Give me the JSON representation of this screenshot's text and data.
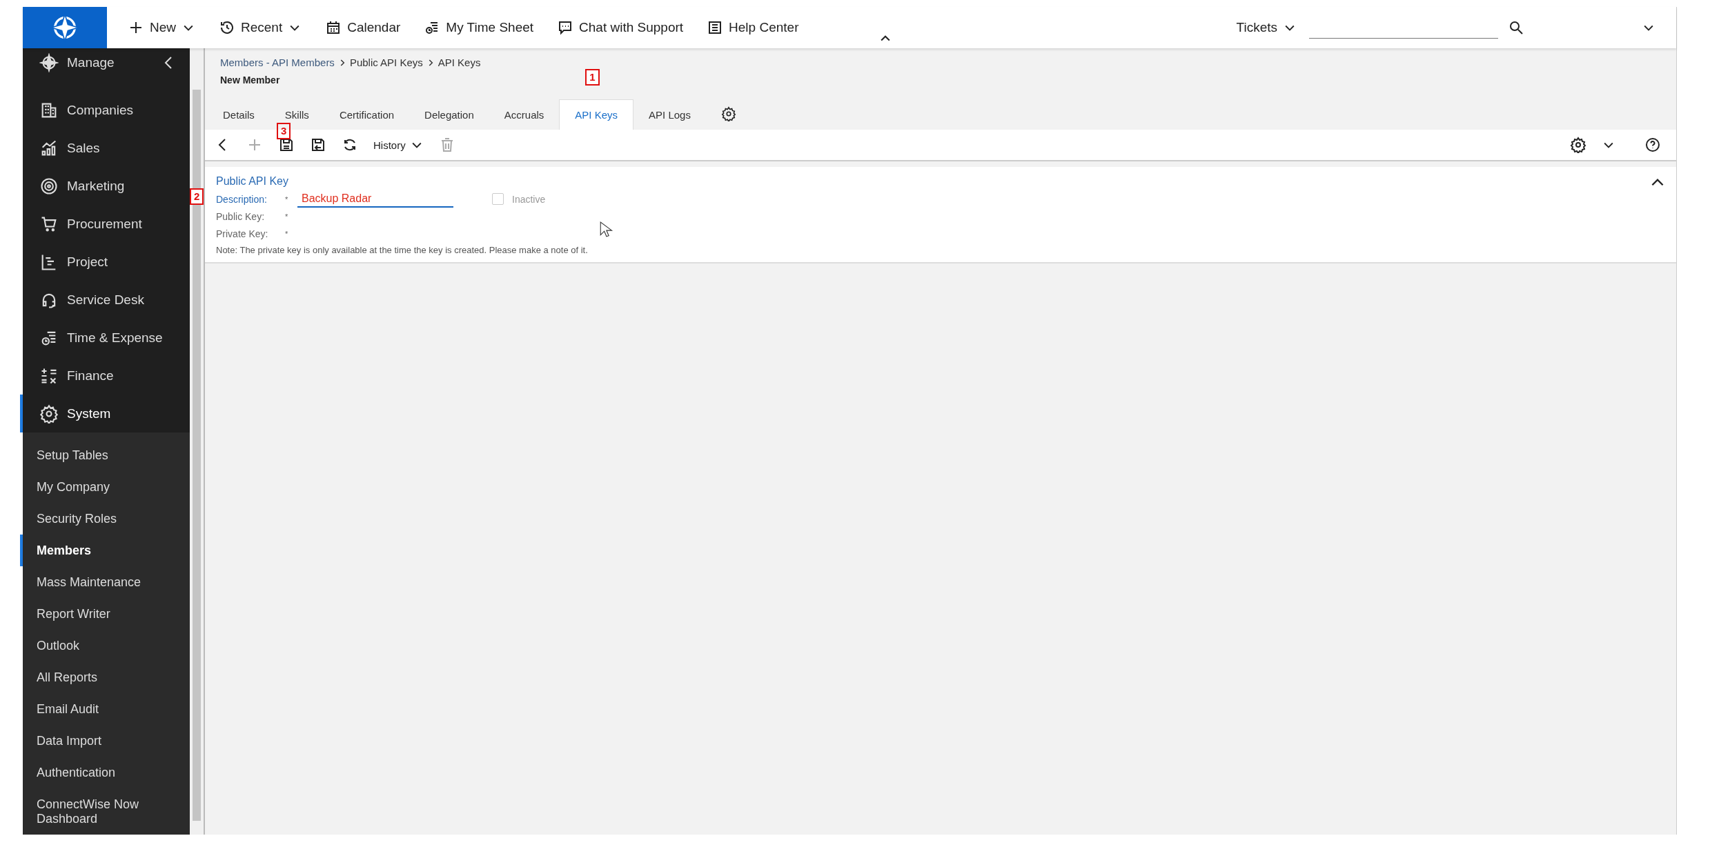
{
  "topbar": {
    "nav": [
      {
        "label": "New",
        "caret": true
      },
      {
        "label": "Recent",
        "caret": true
      },
      {
        "label": "Calendar",
        "caret": false
      },
      {
        "label": "My Time Sheet",
        "caret": false
      },
      {
        "label": "Chat with Support",
        "caret": false
      },
      {
        "label": "Help Center",
        "caret": false
      }
    ],
    "search_scope": "Tickets"
  },
  "sidebar": {
    "header": "Manage",
    "items": [
      {
        "label": "Companies",
        "selected": false
      },
      {
        "label": "Sales",
        "selected": false
      },
      {
        "label": "Marketing",
        "selected": false
      },
      {
        "label": "Procurement",
        "selected": false
      },
      {
        "label": "Project",
        "selected": false
      },
      {
        "label": "Service Desk",
        "selected": false
      },
      {
        "label": "Time & Expense",
        "selected": false
      },
      {
        "label": "Finance",
        "selected": false
      },
      {
        "label": "System",
        "selected": true
      }
    ],
    "subitems": [
      {
        "label": "Setup Tables",
        "selected": false
      },
      {
        "label": "My Company",
        "selected": false
      },
      {
        "label": "Security Roles",
        "selected": false
      },
      {
        "label": "Members",
        "selected": true
      },
      {
        "label": "Mass Maintenance",
        "selected": false
      },
      {
        "label": "Report Writer",
        "selected": false
      },
      {
        "label": "Outlook",
        "selected": false
      },
      {
        "label": "All Reports",
        "selected": false
      },
      {
        "label": "Email Audit",
        "selected": false
      },
      {
        "label": "Data Import",
        "selected": false
      },
      {
        "label": "Authentication",
        "selected": false
      },
      {
        "label": "ConnectWise Now Dashboard",
        "selected": false
      }
    ]
  },
  "breadcrumb": [
    "Members - API Members",
    "Public API Keys",
    "API Keys"
  ],
  "page_title": "New Member",
  "tabs": [
    {
      "label": "Details",
      "selected": false
    },
    {
      "label": "Skills",
      "selected": false
    },
    {
      "label": "Certification",
      "selected": false
    },
    {
      "label": "Delegation",
      "selected": false
    },
    {
      "label": "Accruals",
      "selected": false
    },
    {
      "label": "API Keys",
      "selected": true,
      "marker": "1"
    },
    {
      "label": "API Logs",
      "selected": false
    }
  ],
  "toolbar": [
    {
      "kind": "back",
      "disabled": false
    },
    {
      "kind": "add",
      "disabled": true
    },
    {
      "kind": "save",
      "disabled": false,
      "marker": "3"
    },
    {
      "kind": "save-close",
      "disabled": false
    },
    {
      "kind": "refresh",
      "disabled": false
    },
    {
      "kind": "history",
      "label": "History",
      "disabled": false
    },
    {
      "kind": "delete",
      "disabled": true
    }
  ],
  "form": {
    "title": "Public API Key",
    "fields": [
      {
        "label": "Description:",
        "required": "*",
        "value": "Backup Radar",
        "focused": true,
        "marker": "2"
      },
      {
        "label": "Public Key:",
        "required": "*",
        "focused": false
      },
      {
        "label": "Private Key:",
        "required": "*",
        "focused": false
      }
    ],
    "inactive": {
      "label": "Inactive",
      "checked": false,
      "disabled": true
    },
    "note": "Note: The private key is only available at the time the key is created. Please make a note of it."
  }
}
